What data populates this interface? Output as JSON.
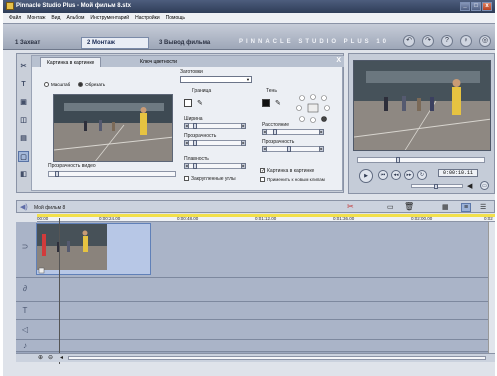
{
  "window": {
    "title": "Pinnacle Studio Plus - Мой фильм 8.stx",
    "controls": [
      "_",
      "□",
      "x"
    ]
  },
  "menu": [
    "Файл",
    "Монтаж",
    "Вид",
    "Альбом",
    "Инструментарий",
    "Настройки",
    "Помощь"
  ],
  "modes": [
    {
      "label": "1 Захват"
    },
    {
      "label": "2 Монтаж"
    },
    {
      "label": "3 Вывод фильма"
    }
  ],
  "brand": "PINNACLE STUDIO PLUS 10",
  "top_icons": [
    "undo-icon",
    "redo-icon",
    "help-icon",
    "bulb-icon",
    "disc-icon"
  ],
  "editor": {
    "tabs": [
      "Картинка в картинке",
      "Ключ цветности"
    ],
    "close": "X",
    "radio_scale": "Масштаб",
    "radio_crop": "Обрезать",
    "presets_label": "Заготовки",
    "border_title": "Граница",
    "width_label": "Ширина",
    "opacity_label": "Прозрачность",
    "softness_label": "Плавность",
    "rounded_label": "Закругленные углы",
    "shadow_title": "Тень",
    "distance_label": "Расстояние",
    "shadow_opacity_label": "Прозрачность",
    "video_opacity_label": "Прозрачность видео",
    "pip_enable": "Картинка в картинке",
    "apply_new": "Применить к новым клипам"
  },
  "player": {
    "timecode": "0:00:10.11"
  },
  "timeline": {
    "project": "Мой фильм 8",
    "ruler": [
      "00:00",
      "0:00:24.00",
      "0:00:48.00",
      "0:01:12.00",
      "0:01:36.00",
      "0:02:00.00",
      "0:02"
    ]
  },
  "colors": {
    "accent": "#5873a5",
    "ruler_yellow": "#f2e04b",
    "titlebar": "#2f3d58"
  }
}
